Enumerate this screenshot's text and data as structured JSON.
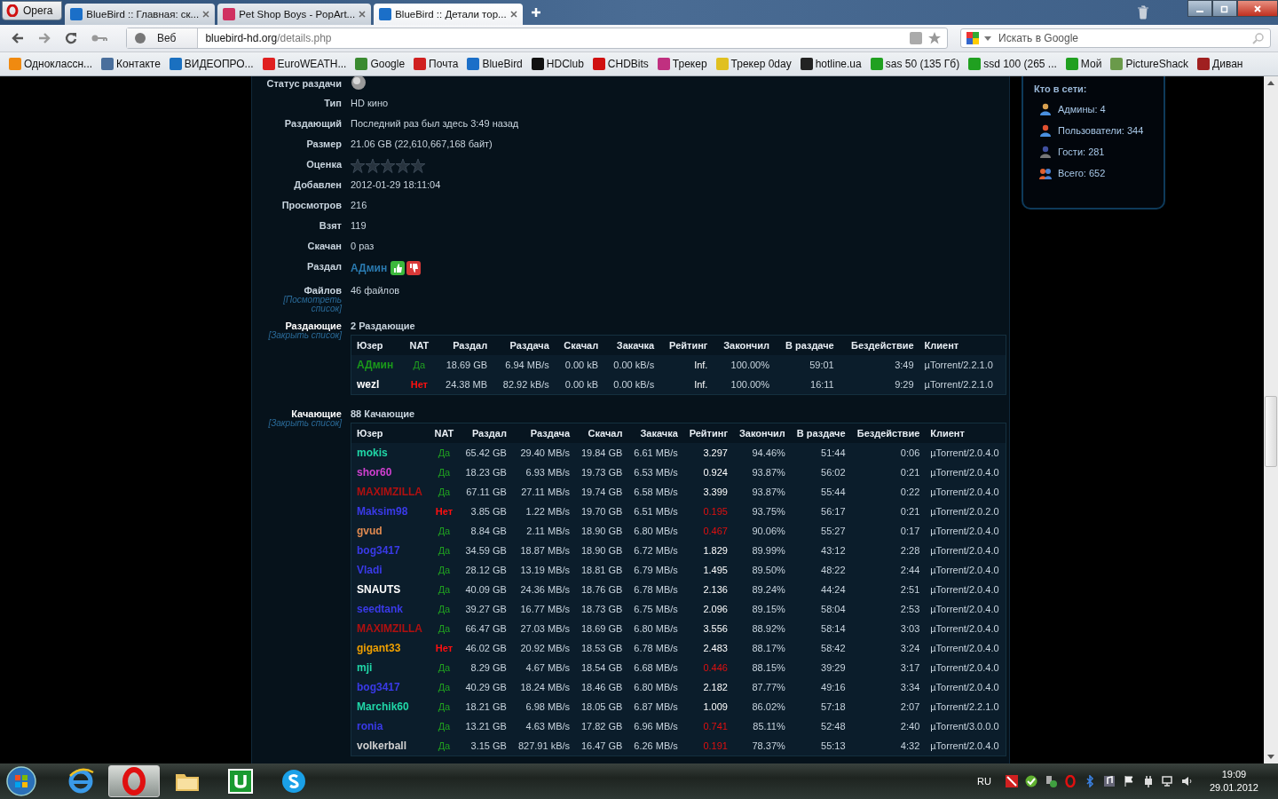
{
  "browser": {
    "menu_button": "Opera",
    "tabs": [
      {
        "title": "BlueBird :: Главная: ск...",
        "selected": false,
        "color": "#1b6fc8"
      },
      {
        "title": "Pet Shop Boys - PopArt...",
        "selected": false,
        "color": "#d03060"
      },
      {
        "title": "BlueBird :: Детали тор...",
        "selected": true,
        "color": "#1b6fc8"
      }
    ],
    "address": {
      "scope": "Веб",
      "host": "bluebird-hd.org",
      "path": "/details.php"
    },
    "search": {
      "placeholder": "Искать в Google"
    },
    "bookmarks": [
      {
        "label": "Одноклассн...",
        "color": "#f08a10"
      },
      {
        "label": "Контакте",
        "color": "#4a6f9c"
      },
      {
        "label": "ВИДЕОПРО...",
        "color": "#1a70c0"
      },
      {
        "label": "EuroWEATH...",
        "color": "#e02020"
      },
      {
        "label": "Google",
        "color": "#3a8a30"
      },
      {
        "label": "Почта",
        "color": "#d02020"
      },
      {
        "label": "BlueBird",
        "color": "#1b6fc8"
      },
      {
        "label": "HDClub",
        "color": "#111111"
      },
      {
        "label": "CHDBits",
        "color": "#d01010"
      },
      {
        "label": "Трекер",
        "color": "#c03080"
      },
      {
        "label": "Трекер 0day",
        "color": "#e0c020"
      },
      {
        "label": "hotline.ua",
        "color": "#222222"
      },
      {
        "label": "sas 50 (135 Гб)",
        "color": "#20a020"
      },
      {
        "label": "ssd 100 (265 ...",
        "color": "#20a020"
      },
      {
        "label": "Мой",
        "color": "#20a020"
      },
      {
        "label": "PictureShack",
        "color": "#6a9a4a"
      },
      {
        "label": "Диван",
        "color": "#a02020"
      }
    ]
  },
  "details": [
    {
      "kind": "status",
      "label": "Статус раздачи"
    },
    {
      "kind": "text",
      "label": "Тип",
      "value": "HD кино"
    },
    {
      "kind": "text",
      "label": "Раздающий",
      "value": "Последний раз был здесь 3:49 назад"
    },
    {
      "kind": "text",
      "label": "Размер",
      "value": "21.06 GB (22,610,667,168 байт)"
    },
    {
      "kind": "stars",
      "label": "Оценка",
      "stars": 0
    },
    {
      "kind": "text",
      "label": "Добавлен",
      "value": "2012-01-29 18:11:04"
    },
    {
      "kind": "text",
      "label": "Просмотров",
      "value": "216"
    },
    {
      "kind": "text",
      "label": "Взят",
      "value": "119"
    },
    {
      "kind": "text",
      "label": "Скачан",
      "value": "0 раз"
    },
    {
      "kind": "uploader",
      "label": "Раздал",
      "value": "АДмин"
    },
    {
      "kind": "files",
      "label": "Файлов",
      "value": "46 файлов",
      "link": "[Посмотреть список]"
    }
  ],
  "peer_sections": [
    {
      "label": "Раздающие",
      "link": "[Закрыть список]",
      "heading": "2 Раздающие",
      "columns": [
        "Юзер",
        "NAT",
        "Раздал",
        "Раздача",
        "Скачал",
        "Закачка",
        "Рейтинг",
        "Закончил",
        "В раздаче",
        "Бездействие",
        "Клиент"
      ],
      "rows": [
        {
          "cells": [
            "АДмин",
            "Да",
            "18.69 GB",
            "6.94 MB/s",
            "0.00 kB",
            "0.00 kB/s",
            "Inf.",
            "100.00%",
            "59:01",
            "3:49",
            "µTorrent/2.2.1.0"
          ],
          "color": "#1a9a1a",
          "nat_ok": true,
          "rating_low": false
        },
        {
          "cells": [
            "wezl",
            "Нет",
            "24.38 MB",
            "82.92 kB/s",
            "0.00 kB",
            "0.00 kB/s",
            "Inf.",
            "100.00%",
            "16:11",
            "9:29",
            "µTorrent/2.2.1.0"
          ],
          "color": "#ffffff",
          "nat_ok": false,
          "rating_low": false
        }
      ]
    },
    {
      "label": "Качающие",
      "link": "[Закрыть список]",
      "heading": "88 Качающие",
      "columns": [
        "Юзер",
        "NAT",
        "Раздал",
        "Раздача",
        "Скачал",
        "Закачка",
        "Рейтинг",
        "Закончил",
        "В раздаче",
        "Бездействие",
        "Клиент"
      ],
      "rows": [
        {
          "cells": [
            "mokis",
            "Да",
            "65.42 GB",
            "29.40 MB/s",
            "19.84 GB",
            "6.61 MB/s",
            "3.297",
            "94.46%",
            "51:44",
            "0:06",
            "µTorrent/2.0.4.0"
          ],
          "color": "#20d8a8",
          "nat_ok": true,
          "rating_low": false
        },
        {
          "cells": [
            "shor60",
            "Да",
            "18.23 GB",
            "6.93 MB/s",
            "19.73 GB",
            "6.53 MB/s",
            "0.924",
            "93.87%",
            "56:02",
            "0:21",
            "µTorrent/2.0.4.0"
          ],
          "color": "#d040d0",
          "nat_ok": true,
          "rating_low": false
        },
        {
          "cells": [
            "MAXIMZILLA",
            "Да",
            "67.11 GB",
            "27.11 MB/s",
            "19.74 GB",
            "6.58 MB/s",
            "3.399",
            "93.87%",
            "55:44",
            "0:22",
            "µTorrent/2.0.4.0"
          ],
          "color": "#b01010",
          "nat_ok": true,
          "rating_low": false
        },
        {
          "cells": [
            "Maksim98",
            "Нет",
            "3.85 GB",
            "1.22 MB/s",
            "19.70 GB",
            "6.51 MB/s",
            "0.195",
            "93.75%",
            "56:17",
            "0:21",
            "µTorrent/2.0.2.0"
          ],
          "color": "#3a3ae8",
          "nat_ok": false,
          "rating_low": true
        },
        {
          "cells": [
            "gvud",
            "Да",
            "8.84 GB",
            "2.11 MB/s",
            "18.90 GB",
            "6.80 MB/s",
            "0.467",
            "90.06%",
            "55:27",
            "0:17",
            "µTorrent/2.0.4.0"
          ],
          "color": "#e08a50",
          "nat_ok": true,
          "rating_low": true
        },
        {
          "cells": [
            "bog3417",
            "Да",
            "34.59 GB",
            "18.87 MB/s",
            "18.90 GB",
            "6.72 MB/s",
            "1.829",
            "89.99%",
            "43:12",
            "2:28",
            "µTorrent/2.0.4.0"
          ],
          "color": "#3a3ae8",
          "nat_ok": true,
          "rating_low": false
        },
        {
          "cells": [
            "Vladi",
            "Да",
            "28.12 GB",
            "13.19 MB/s",
            "18.81 GB",
            "6.79 MB/s",
            "1.495",
            "89.50%",
            "48:22",
            "2:44",
            "µTorrent/2.0.4.0"
          ],
          "color": "#3a3ae8",
          "nat_ok": true,
          "rating_low": false
        },
        {
          "cells": [
            "SNAUTS",
            "Да",
            "40.09 GB",
            "24.36 MB/s",
            "18.76 GB",
            "6.78 MB/s",
            "2.136",
            "89.24%",
            "44:24",
            "2:51",
            "µTorrent/2.0.4.0"
          ],
          "color": "#ffffff",
          "nat_ok": true,
          "rating_low": false
        },
        {
          "cells": [
            "seedtank",
            "Да",
            "39.27 GB",
            "16.77 MB/s",
            "18.73 GB",
            "6.75 MB/s",
            "2.096",
            "89.15%",
            "58:04",
            "2:53",
            "µTorrent/2.0.4.0"
          ],
          "color": "#3a3ae8",
          "nat_ok": true,
          "rating_low": false
        },
        {
          "cells": [
            "MAXIMZILLA",
            "Да",
            "66.47 GB",
            "27.03 MB/s",
            "18.69 GB",
            "6.80 MB/s",
            "3.556",
            "88.92%",
            "58:14",
            "3:03",
            "µTorrent/2.0.4.0"
          ],
          "color": "#b01010",
          "nat_ok": true,
          "rating_low": false
        },
        {
          "cells": [
            "gigant33",
            "Нет",
            "46.02 GB",
            "20.92 MB/s",
            "18.53 GB",
            "6.78 MB/s",
            "2.483",
            "88.17%",
            "58:42",
            "3:24",
            "µTorrent/2.0.4.0"
          ],
          "color": "#f0a000",
          "nat_ok": false,
          "rating_low": false
        },
        {
          "cells": [
            "mji",
            "Да",
            "8.29 GB",
            "4.67 MB/s",
            "18.54 GB",
            "6.68 MB/s",
            "0.446",
            "88.15%",
            "39:29",
            "3:17",
            "µTorrent/2.0.4.0"
          ],
          "color": "#20d8a8",
          "nat_ok": true,
          "rating_low": true
        },
        {
          "cells": [
            "bog3417",
            "Да",
            "40.29 GB",
            "18.24 MB/s",
            "18.46 GB",
            "6.80 MB/s",
            "2.182",
            "87.77%",
            "49:16",
            "3:34",
            "µTorrent/2.0.4.0"
          ],
          "color": "#3a3ae8",
          "nat_ok": true,
          "rating_low": false
        },
        {
          "cells": [
            "Marchik60",
            "Да",
            "18.21 GB",
            "6.98 MB/s",
            "18.05 GB",
            "6.87 MB/s",
            "1.009",
            "86.02%",
            "57:18",
            "2:07",
            "µTorrent/2.2.1.0"
          ],
          "color": "#20d8a8",
          "nat_ok": true,
          "rating_low": false
        },
        {
          "cells": [
            "ronia",
            "Да",
            "13.21 GB",
            "4.63 MB/s",
            "17.82 GB",
            "6.96 MB/s",
            "0.741",
            "85.11%",
            "52:48",
            "2:40",
            "µTorrent/3.0.0.0"
          ],
          "color": "#3a3ae8",
          "nat_ok": true,
          "rating_low": true
        },
        {
          "cells": [
            "volkerball",
            "Да",
            "3.15 GB",
            "827.91 kB/s",
            "16.47 GB",
            "6.26 MB/s",
            "0.191",
            "78.37%",
            "55:13",
            "4:32",
            "µTorrent/2.0.4.0"
          ],
          "color": "#d0d0d0",
          "nat_ok": true,
          "rating_low": true
        }
      ]
    }
  ],
  "online": {
    "title": "Кто в сети:",
    "items": [
      {
        "kind": "admin",
        "label": "Админы: 4"
      },
      {
        "kind": "user",
        "label": "Пользователи: 344"
      },
      {
        "kind": "guest",
        "label": "Гости: 281"
      },
      {
        "kind": "total",
        "label": "Всего: 652"
      }
    ]
  },
  "taskbar": {
    "apps": [
      {
        "kind": "ie",
        "selected": false
      },
      {
        "kind": "opera",
        "selected": true
      },
      {
        "kind": "folder",
        "selected": false
      },
      {
        "kind": "torrent",
        "selected": false
      },
      {
        "kind": "skype",
        "selected": false
      }
    ],
    "language": "RU",
    "time": "19:09",
    "date": "29.01.2012"
  }
}
